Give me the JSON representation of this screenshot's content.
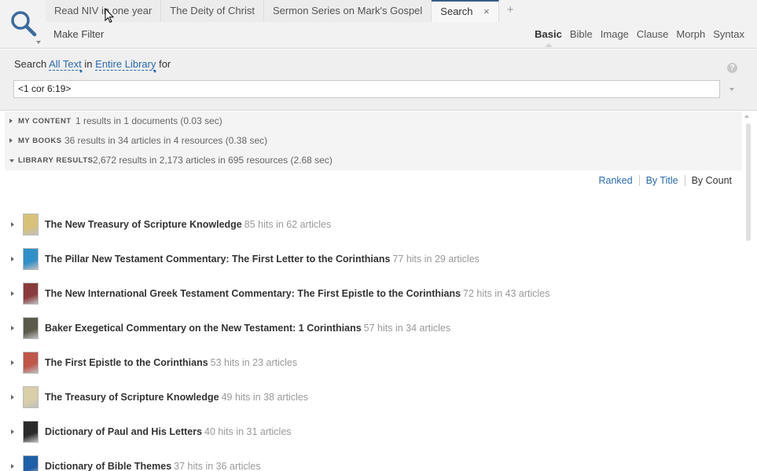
{
  "tabs": [
    {
      "label": "Read NIV in one year",
      "active": false
    },
    {
      "label": "The Deity of Christ",
      "active": false
    },
    {
      "label": "Sermon Series on Mark's Gospel",
      "active": false
    },
    {
      "label": "Search",
      "active": true,
      "close": "×"
    }
  ],
  "tab_add": "+",
  "toolbar": {
    "make_filter": "Make Filter"
  },
  "search_kinds": [
    "Basic",
    "Bible",
    "Image",
    "Clause",
    "Morph",
    "Syntax"
  ],
  "search_kind_active": "Basic",
  "query": {
    "prefix": "Search",
    "scope_text": "All Text",
    "in": "in",
    "library": "Entire Library",
    "for": "for",
    "value": "<1 cor 6:19>",
    "help": "?"
  },
  "sections": [
    {
      "label": "MY CONTENT",
      "stats": "1 results in 1 documents (0.03 sec)",
      "expanded": false
    },
    {
      "label": "MY BOOKS",
      "stats": "36 results in 34 articles in 4 resources (0.38 sec)",
      "expanded": false
    },
    {
      "label": "LIBRARY RESULTS",
      "stats": "2,672 results in 2,173 articles in 695 resources (2.68 sec)",
      "expanded": true
    }
  ],
  "sort": [
    "Ranked",
    "By Title",
    "By Count"
  ],
  "sort_active": "By Count",
  "results": [
    {
      "title": "The New Treasury of Scripture Knowledge",
      "hits": "85 hits in 62 articles",
      "cover": "#d8c27a"
    },
    {
      "title": "The Pillar New Testament Commentary: The First Letter to the Corinthians",
      "hits": "77 hits in 29 articles",
      "cover": "#2f8fc8"
    },
    {
      "title": "The New International Greek Testament Commentary: The First Epistle to the Corinthians",
      "hits": "72 hits in 43 articles",
      "cover": "#8a3b3b"
    },
    {
      "title": "Baker Exegetical Commentary on the New Testament: 1 Corinthians",
      "hits": "57 hits in 34 articles",
      "cover": "#5a5a4a"
    },
    {
      "title": "The First Epistle to the Corinthians",
      "hits": "53 hits in 23 articles",
      "cover": "#c0564a"
    },
    {
      "title": "The Treasury of Scripture Knowledge",
      "hits": "49 hits in 38 articles",
      "cover": "#d9cfa8"
    },
    {
      "title": "Dictionary of Paul and His Letters",
      "hits": "40 hits in 31 articles",
      "cover": "#2a2a2a"
    },
    {
      "title": "Dictionary of Bible Themes",
      "hits": "37 hits in 36 articles",
      "cover": "#1f5fa8"
    }
  ]
}
